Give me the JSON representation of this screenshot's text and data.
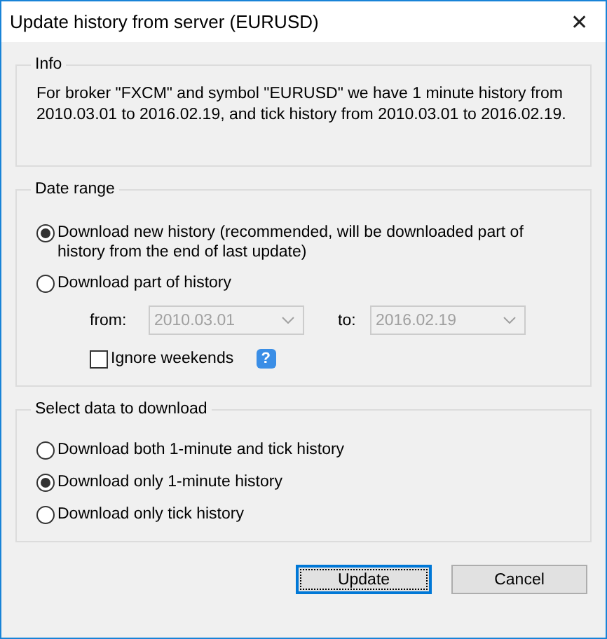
{
  "window": {
    "title": "Update history from server (EURUSD)",
    "close": "✕"
  },
  "info": {
    "title": "Info",
    "text": "For broker \"FXCM\" and symbol \"EURUSD\" we have 1 minute history from 2010.03.01 to 2016.02.19, and tick history from 2010.03.01 to 2016.02.19."
  },
  "date_range": {
    "title": "Date range",
    "options": [
      {
        "label": "Download new history (recommended, will be downloaded part of history from the end of last update)",
        "selected": true
      },
      {
        "label": "Download part of history",
        "selected": false
      }
    ],
    "from": {
      "label": "from:",
      "value": "2010.03.01",
      "disabled": true
    },
    "to": {
      "label": "to:",
      "value": "2016.02.19",
      "disabled": true
    },
    "ignore_weekends": {
      "label": "Ignore weekends",
      "checked": false
    },
    "help": "?"
  },
  "select_data": {
    "title": "Select data to download",
    "options": [
      {
        "label": "Download both 1-minute and tick history",
        "selected": false
      },
      {
        "label": "Download only 1-minute history",
        "selected": true
      },
      {
        "label": "Download only tick history",
        "selected": false
      }
    ]
  },
  "buttons": [
    {
      "label": "Update",
      "focused": true
    },
    {
      "label": "Cancel",
      "focused": false
    }
  ]
}
